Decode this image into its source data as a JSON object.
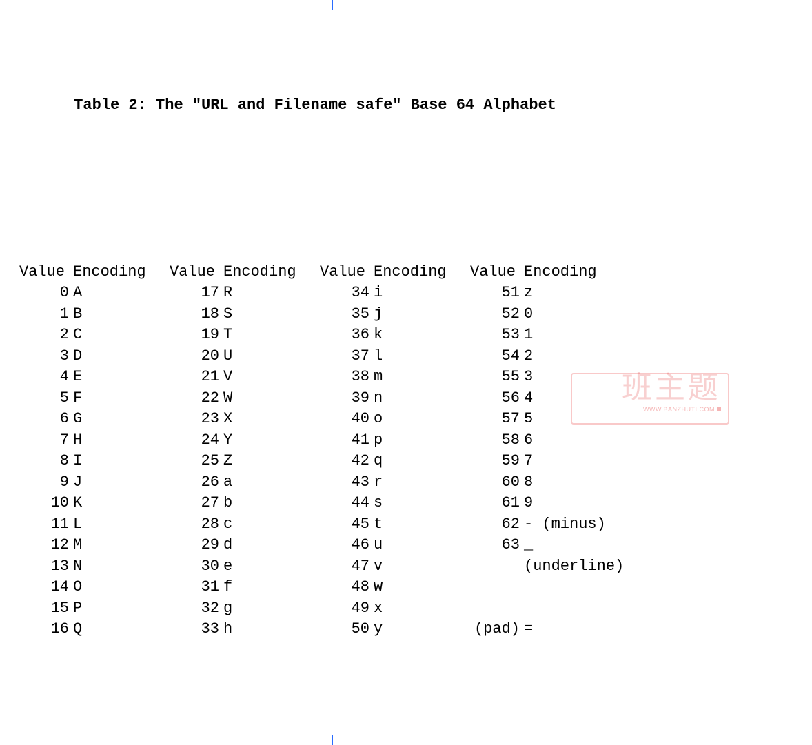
{
  "title": "Table 2: The \"URL and Filename safe\" Base 64 Alphabet",
  "title_indent": "      ",
  "hdr": {
    "value": "Value",
    "encoding": "Encoding"
  },
  "chart_data": {
    "type": "table",
    "title": "The \"URL and Filename safe\" Base 64 Alphabet",
    "columns": [
      {
        "header_value": "Value",
        "header_encoding": "Encoding",
        "rows": [
          {
            "value": "0",
            "encoding": "A"
          },
          {
            "value": "1",
            "encoding": "B"
          },
          {
            "value": "2",
            "encoding": "C"
          },
          {
            "value": "3",
            "encoding": "D"
          },
          {
            "value": "4",
            "encoding": "E"
          },
          {
            "value": "5",
            "encoding": "F"
          },
          {
            "value": "6",
            "encoding": "G"
          },
          {
            "value": "7",
            "encoding": "H"
          },
          {
            "value": "8",
            "encoding": "I"
          },
          {
            "value": "9",
            "encoding": "J"
          },
          {
            "value": "10",
            "encoding": "K"
          },
          {
            "value": "11",
            "encoding": "L"
          },
          {
            "value": "12",
            "encoding": "M"
          },
          {
            "value": "13",
            "encoding": "N"
          },
          {
            "value": "14",
            "encoding": "O"
          },
          {
            "value": "15",
            "encoding": "P"
          },
          {
            "value": "16",
            "encoding": "Q"
          }
        ]
      },
      {
        "header_value": "Value",
        "header_encoding": "Encoding",
        "rows": [
          {
            "value": "17",
            "encoding": "R"
          },
          {
            "value": "18",
            "encoding": "S"
          },
          {
            "value": "19",
            "encoding": "T"
          },
          {
            "value": "20",
            "encoding": "U"
          },
          {
            "value": "21",
            "encoding": "V"
          },
          {
            "value": "22",
            "encoding": "W"
          },
          {
            "value": "23",
            "encoding": "X"
          },
          {
            "value": "24",
            "encoding": "Y"
          },
          {
            "value": "25",
            "encoding": "Z"
          },
          {
            "value": "26",
            "encoding": "a"
          },
          {
            "value": "27",
            "encoding": "b"
          },
          {
            "value": "28",
            "encoding": "c"
          },
          {
            "value": "29",
            "encoding": "d"
          },
          {
            "value": "30",
            "encoding": "e"
          },
          {
            "value": "31",
            "encoding": "f"
          },
          {
            "value": "32",
            "encoding": "g"
          },
          {
            "value": "33",
            "encoding": "h"
          }
        ]
      },
      {
        "header_value": "Value",
        "header_encoding": "Encoding",
        "rows": [
          {
            "value": "34",
            "encoding": "i"
          },
          {
            "value": "35",
            "encoding": "j"
          },
          {
            "value": "36",
            "encoding": "k"
          },
          {
            "value": "37",
            "encoding": "l"
          },
          {
            "value": "38",
            "encoding": "m"
          },
          {
            "value": "39",
            "encoding": "n"
          },
          {
            "value": "40",
            "encoding": "o"
          },
          {
            "value": "41",
            "encoding": "p"
          },
          {
            "value": "42",
            "encoding": "q"
          },
          {
            "value": "43",
            "encoding": "r"
          },
          {
            "value": "44",
            "encoding": "s"
          },
          {
            "value": "45",
            "encoding": "t"
          },
          {
            "value": "46",
            "encoding": "u"
          },
          {
            "value": "47",
            "encoding": "v"
          },
          {
            "value": "48",
            "encoding": "w"
          },
          {
            "value": "49",
            "encoding": "x"
          },
          {
            "value": "50",
            "encoding": "y"
          }
        ]
      },
      {
        "header_value": "Value",
        "header_encoding": "Encoding",
        "rows": [
          {
            "value": "51",
            "encoding": "z"
          },
          {
            "value": "52",
            "encoding": "0"
          },
          {
            "value": "53",
            "encoding": "1"
          },
          {
            "value": "54",
            "encoding": "2"
          },
          {
            "value": "55",
            "encoding": "3"
          },
          {
            "value": "56",
            "encoding": "4"
          },
          {
            "value": "57",
            "encoding": "5"
          },
          {
            "value": "58",
            "encoding": "6"
          },
          {
            "value": "59",
            "encoding": "7"
          },
          {
            "value": "60",
            "encoding": "8"
          },
          {
            "value": "61",
            "encoding": "9"
          },
          {
            "value": "62",
            "encoding": "- (minus)"
          },
          {
            "value": "63",
            "encoding": "_"
          },
          {
            "value": "",
            "encoding": "(underline)"
          },
          {
            "value": "",
            "encoding": ""
          },
          {
            "value": "",
            "encoding": ""
          },
          {
            "value": "(pad)",
            "encoding": "="
          }
        ]
      }
    ]
  },
  "watermark": {
    "main": "班主题",
    "sub": "WWW.BANZHUTI.COM"
  }
}
